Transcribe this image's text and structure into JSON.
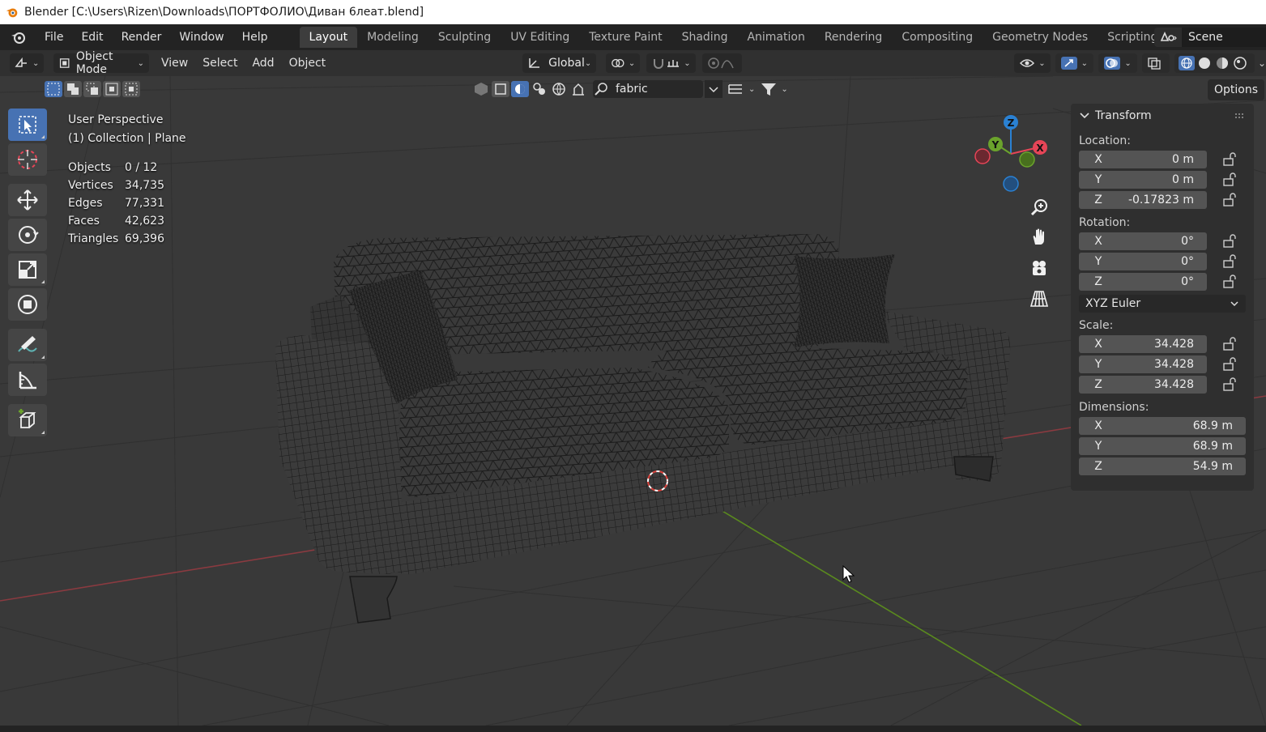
{
  "window": {
    "title": "Blender [C:\\Users\\Rizen\\Downloads\\ПОРТФОЛИО\\Диван 6леат.blend]"
  },
  "menu": [
    "File",
    "Edit",
    "Render",
    "Window",
    "Help"
  ],
  "workspaces": [
    "Layout",
    "Modeling",
    "Sculpting",
    "UV Editing",
    "Texture Paint",
    "Shading",
    "Animation",
    "Rendering",
    "Compositing",
    "Geometry Nodes",
    "Scripting"
  ],
  "active_workspace": "Layout",
  "scene": {
    "name": "Scene"
  },
  "header": {
    "mode": "Object Mode",
    "menus": [
      "View",
      "Select",
      "Add",
      "Object"
    ],
    "orientation": "Global",
    "search_value": "fabric",
    "options_label": "Options"
  },
  "overlay": {
    "view_name": "User Perspective",
    "collection": "(1) Collection | Plane",
    "stats": [
      {
        "label": "Objects",
        "value": "0 / 12"
      },
      {
        "label": "Vertices",
        "value": "34,735"
      },
      {
        "label": "Edges",
        "value": "77,331"
      },
      {
        "label": "Faces",
        "value": "42,623"
      },
      {
        "label": "Triangles",
        "value": "69,396"
      }
    ]
  },
  "gizmo": {
    "x": "X",
    "y": "Y",
    "z": "Z"
  },
  "npanel": {
    "title": "Transform",
    "location_label": "Location:",
    "location": [
      {
        "axis": "X",
        "value": "0 m"
      },
      {
        "axis": "Y",
        "value": "0 m"
      },
      {
        "axis": "Z",
        "value": "-0.17823 m"
      }
    ],
    "rotation_label": "Rotation:",
    "rotation": [
      {
        "axis": "X",
        "value": "0°"
      },
      {
        "axis": "Y",
        "value": "0°"
      },
      {
        "axis": "Z",
        "value": "0°"
      }
    ],
    "rotation_mode": "XYZ Euler",
    "scale_label": "Scale:",
    "scale": [
      {
        "axis": "X",
        "value": "34.428"
      },
      {
        "axis": "Y",
        "value": "34.428"
      },
      {
        "axis": "Z",
        "value": "34.428"
      }
    ],
    "dimensions_label": "Dimensions:",
    "dimensions": [
      {
        "axis": "X",
        "value": "68.9 m"
      },
      {
        "axis": "Y",
        "value": "68.9 m"
      },
      {
        "axis": "Z",
        "value": "54.9 m"
      }
    ]
  },
  "colors": {
    "accent": "#4772b3",
    "x_axis": "#e64557",
    "y_axis": "#6ba32c",
    "z_axis": "#2a81d3"
  }
}
